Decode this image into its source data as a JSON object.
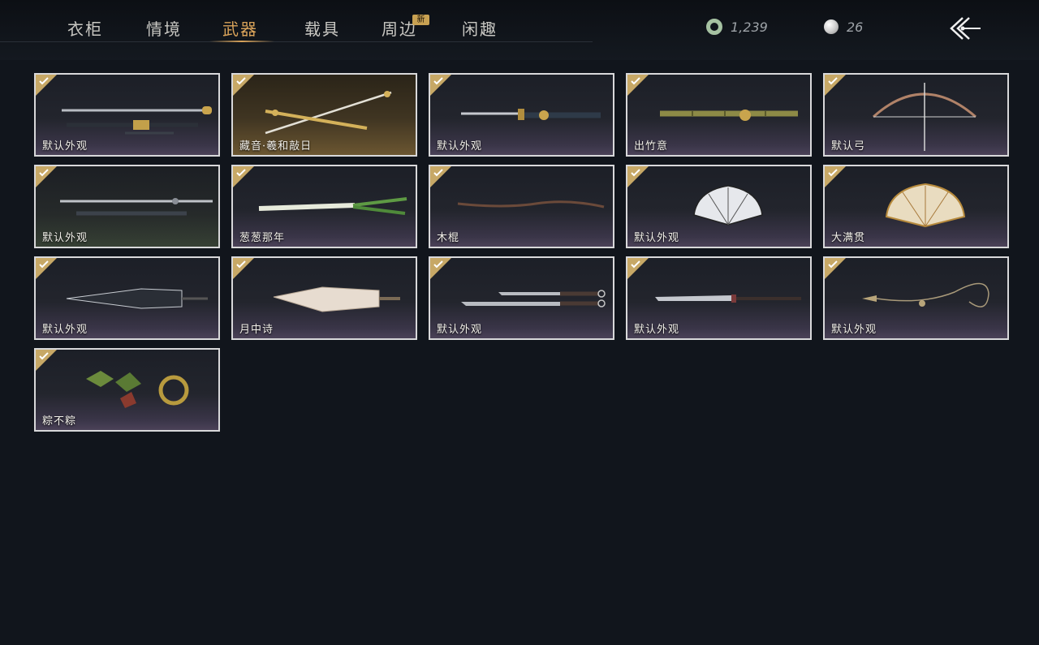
{
  "tabs": [
    {
      "label": "衣柜"
    },
    {
      "label": "情境"
    },
    {
      "label": "武器"
    },
    {
      "label": "载具"
    },
    {
      "label": "周边"
    },
    {
      "label": "闲趣"
    }
  ],
  "active_tab": "武器",
  "new_badge": "新",
  "currency": {
    "jade": "1,239",
    "pearl": "26"
  },
  "items": [
    {
      "name": "默认外观",
      "icon": "sword-and-scabbard-icon",
      "owned": true
    },
    {
      "name": "藏音·羲和敲日",
      "icon": "golden-crossed-staff-icon",
      "owned": true
    },
    {
      "name": "默认外观",
      "icon": "ornate-dagger-icon",
      "owned": true
    },
    {
      "name": "出竹意",
      "icon": "bamboo-staff-icon",
      "owned": true
    },
    {
      "name": "默认弓",
      "icon": "bow-icon",
      "owned": true
    },
    {
      "name": "默认外观",
      "icon": "spear-pair-icon",
      "owned": true
    },
    {
      "name": "葱葱那年",
      "icon": "scallion-icon",
      "owned": true
    },
    {
      "name": "木棍",
      "icon": "wooden-stick-icon",
      "owned": true
    },
    {
      "name": "默认外观",
      "icon": "folding-fan-icon",
      "owned": true
    },
    {
      "name": "大满贯",
      "icon": "golden-fan-icon",
      "owned": true
    },
    {
      "name": "默认外观",
      "icon": "umbrella-icon",
      "owned": true
    },
    {
      "name": "月中诗",
      "icon": "paper-umbrella-icon",
      "owned": true
    },
    {
      "name": "默认外观",
      "icon": "twin-blades-icon",
      "owned": true
    },
    {
      "name": "默认外观",
      "icon": "long-blade-icon",
      "owned": true
    },
    {
      "name": "默认外观",
      "icon": "rope-dart-icon",
      "owned": true
    },
    {
      "name": "粽不粽",
      "icon": "zongzi-weapon-icon",
      "owned": true
    }
  ]
}
